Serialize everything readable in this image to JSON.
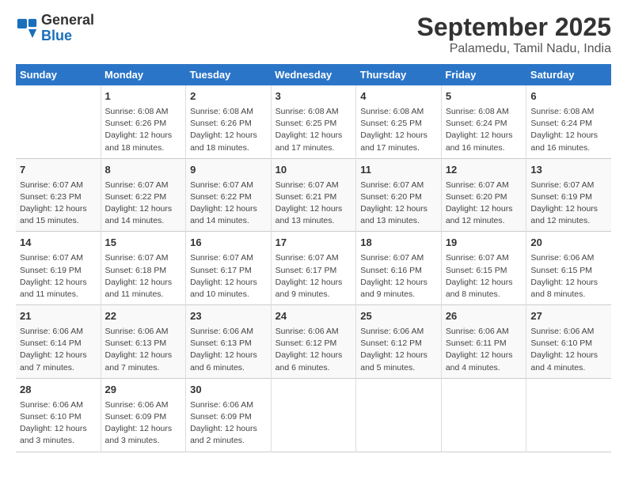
{
  "logo": {
    "line1": "General",
    "line2": "Blue"
  },
  "title": "September 2025",
  "subtitle": "Palamedu, Tamil Nadu, India",
  "days_header": [
    "Sunday",
    "Monday",
    "Tuesday",
    "Wednesday",
    "Thursday",
    "Friday",
    "Saturday"
  ],
  "weeks": [
    [
      {
        "num": "",
        "info": ""
      },
      {
        "num": "1",
        "info": "Sunrise: 6:08 AM\nSunset: 6:26 PM\nDaylight: 12 hours\nand 18 minutes."
      },
      {
        "num": "2",
        "info": "Sunrise: 6:08 AM\nSunset: 6:26 PM\nDaylight: 12 hours\nand 18 minutes."
      },
      {
        "num": "3",
        "info": "Sunrise: 6:08 AM\nSunset: 6:25 PM\nDaylight: 12 hours\nand 17 minutes."
      },
      {
        "num": "4",
        "info": "Sunrise: 6:08 AM\nSunset: 6:25 PM\nDaylight: 12 hours\nand 17 minutes."
      },
      {
        "num": "5",
        "info": "Sunrise: 6:08 AM\nSunset: 6:24 PM\nDaylight: 12 hours\nand 16 minutes."
      },
      {
        "num": "6",
        "info": "Sunrise: 6:08 AM\nSunset: 6:24 PM\nDaylight: 12 hours\nand 16 minutes."
      }
    ],
    [
      {
        "num": "7",
        "info": "Sunrise: 6:07 AM\nSunset: 6:23 PM\nDaylight: 12 hours\nand 15 minutes."
      },
      {
        "num": "8",
        "info": "Sunrise: 6:07 AM\nSunset: 6:22 PM\nDaylight: 12 hours\nand 14 minutes."
      },
      {
        "num": "9",
        "info": "Sunrise: 6:07 AM\nSunset: 6:22 PM\nDaylight: 12 hours\nand 14 minutes."
      },
      {
        "num": "10",
        "info": "Sunrise: 6:07 AM\nSunset: 6:21 PM\nDaylight: 12 hours\nand 13 minutes."
      },
      {
        "num": "11",
        "info": "Sunrise: 6:07 AM\nSunset: 6:20 PM\nDaylight: 12 hours\nand 13 minutes."
      },
      {
        "num": "12",
        "info": "Sunrise: 6:07 AM\nSunset: 6:20 PM\nDaylight: 12 hours\nand 12 minutes."
      },
      {
        "num": "13",
        "info": "Sunrise: 6:07 AM\nSunset: 6:19 PM\nDaylight: 12 hours\nand 12 minutes."
      }
    ],
    [
      {
        "num": "14",
        "info": "Sunrise: 6:07 AM\nSunset: 6:19 PM\nDaylight: 12 hours\nand 11 minutes."
      },
      {
        "num": "15",
        "info": "Sunrise: 6:07 AM\nSunset: 6:18 PM\nDaylight: 12 hours\nand 11 minutes."
      },
      {
        "num": "16",
        "info": "Sunrise: 6:07 AM\nSunset: 6:17 PM\nDaylight: 12 hours\nand 10 minutes."
      },
      {
        "num": "17",
        "info": "Sunrise: 6:07 AM\nSunset: 6:17 PM\nDaylight: 12 hours\nand 9 minutes."
      },
      {
        "num": "18",
        "info": "Sunrise: 6:07 AM\nSunset: 6:16 PM\nDaylight: 12 hours\nand 9 minutes."
      },
      {
        "num": "19",
        "info": "Sunrise: 6:07 AM\nSunset: 6:15 PM\nDaylight: 12 hours\nand 8 minutes."
      },
      {
        "num": "20",
        "info": "Sunrise: 6:06 AM\nSunset: 6:15 PM\nDaylight: 12 hours\nand 8 minutes."
      }
    ],
    [
      {
        "num": "21",
        "info": "Sunrise: 6:06 AM\nSunset: 6:14 PM\nDaylight: 12 hours\nand 7 minutes."
      },
      {
        "num": "22",
        "info": "Sunrise: 6:06 AM\nSunset: 6:13 PM\nDaylight: 12 hours\nand 7 minutes."
      },
      {
        "num": "23",
        "info": "Sunrise: 6:06 AM\nSunset: 6:13 PM\nDaylight: 12 hours\nand 6 minutes."
      },
      {
        "num": "24",
        "info": "Sunrise: 6:06 AM\nSunset: 6:12 PM\nDaylight: 12 hours\nand 6 minutes."
      },
      {
        "num": "25",
        "info": "Sunrise: 6:06 AM\nSunset: 6:12 PM\nDaylight: 12 hours\nand 5 minutes."
      },
      {
        "num": "26",
        "info": "Sunrise: 6:06 AM\nSunset: 6:11 PM\nDaylight: 12 hours\nand 4 minutes."
      },
      {
        "num": "27",
        "info": "Sunrise: 6:06 AM\nSunset: 6:10 PM\nDaylight: 12 hours\nand 4 minutes."
      }
    ],
    [
      {
        "num": "28",
        "info": "Sunrise: 6:06 AM\nSunset: 6:10 PM\nDaylight: 12 hours\nand 3 minutes."
      },
      {
        "num": "29",
        "info": "Sunrise: 6:06 AM\nSunset: 6:09 PM\nDaylight: 12 hours\nand 3 minutes."
      },
      {
        "num": "30",
        "info": "Sunrise: 6:06 AM\nSunset: 6:09 PM\nDaylight: 12 hours\nand 2 minutes."
      },
      {
        "num": "",
        "info": ""
      },
      {
        "num": "",
        "info": ""
      },
      {
        "num": "",
        "info": ""
      },
      {
        "num": "",
        "info": ""
      }
    ]
  ]
}
